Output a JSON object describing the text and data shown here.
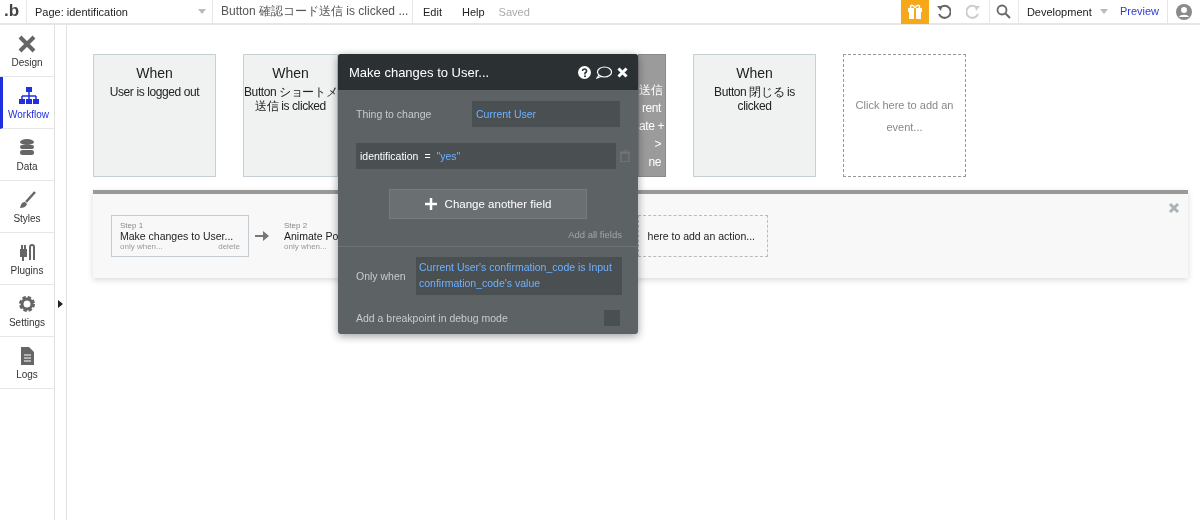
{
  "topbar": {
    "logo": ".b",
    "page_selector": "Page: identification",
    "event_selector": "Button 確認コード送信 is clicked ...",
    "menu": [
      "Edit",
      "Help"
    ],
    "save_status": "Saved",
    "undo": {
      "disabled": false
    },
    "redo": {
      "disabled": true
    },
    "version_selector": "Development",
    "preview": "Preview"
  },
  "sidebar": {
    "items": [
      {
        "label": "Design",
        "selected": false
      },
      {
        "label": "Workflow",
        "selected": true
      },
      {
        "label": "Data",
        "selected": false
      },
      {
        "label": "Styles",
        "selected": false
      },
      {
        "label": "Plugins",
        "selected": false
      },
      {
        "label": "Settings",
        "selected": false
      },
      {
        "label": "Logs",
        "selected": false
      }
    ]
  },
  "events": [
    {
      "kind": "event",
      "title": "When",
      "lines": [
        "User is logged out"
      ],
      "selected": false
    },
    {
      "kind": "event",
      "title": "When",
      "lines": [
        "Button ショートメ",
        "送信 is clicked"
      ],
      "selected": false
    },
    {
      "kind": "event",
      "lines": [
        "送信",
        "rent",
        "ate +",
        ">",
        "ne"
      ],
      "selected": true
    },
    {
      "kind": "event",
      "title": "When",
      "lines": [
        "Button 閉じる is",
        "clicked"
      ],
      "selected": false
    },
    {
      "kind": "add",
      "label": "Click here to add an event..."
    }
  ],
  "actions": {
    "steps": [
      {
        "step": "Step 1",
        "title": "Make changes to User...",
        "condition": "only when...",
        "delete": "delete",
        "selected": true
      },
      {
        "step": "Step 2",
        "title": "Animate Po",
        "condition": "only when...",
        "selected": false
      }
    ],
    "add_action": "here to add an action..."
  },
  "popup": {
    "title": "Make changes to User...",
    "thing_to_change": {
      "label": "Thing to change",
      "value": "Current User"
    },
    "fields": [
      {
        "name": "identification",
        "operator": "=",
        "value": "\"yes\""
      }
    ],
    "change_button": "Change another field",
    "add_all": "Add all fields",
    "only_when": {
      "label": "Only when",
      "value": "Current User's confirmation_code is Input confirmation_code's value"
    },
    "breakpoint": {
      "label": "Add a breakpoint in debug mode",
      "checked": false
    }
  }
}
